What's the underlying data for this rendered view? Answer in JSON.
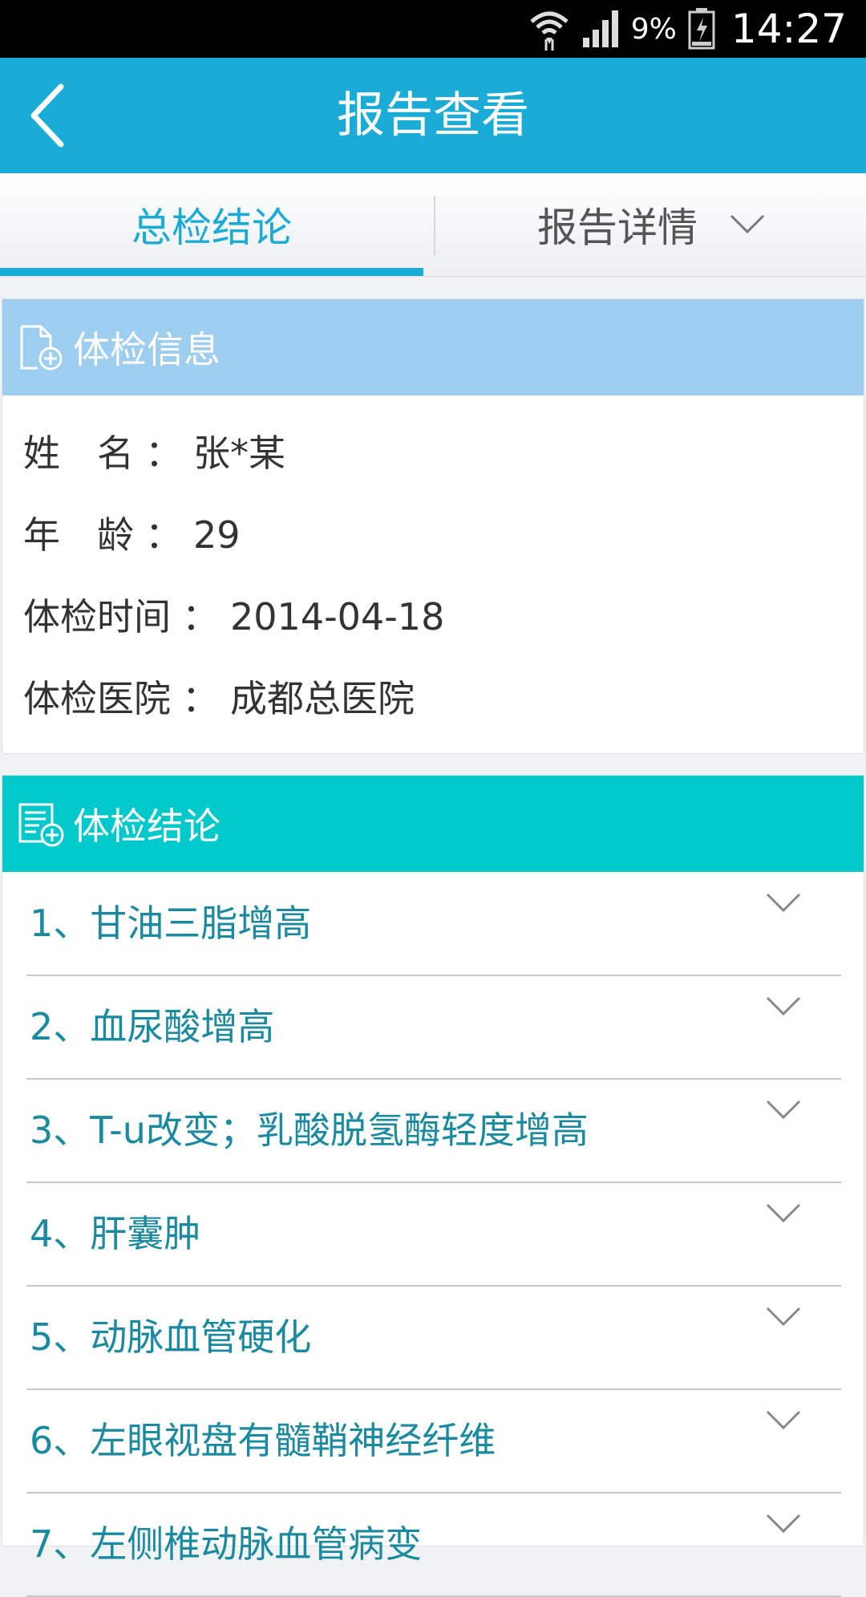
{
  "status_bar": {
    "battery_percent": "9%",
    "time": "14:27"
  },
  "header": {
    "title": "报告查看"
  },
  "tabs": [
    {
      "label": "总检结论",
      "active": true
    },
    {
      "label": "报告详情",
      "active": false
    }
  ],
  "info_section": {
    "title": "体检信息",
    "rows": [
      {
        "label": "姓　名",
        "value": "张*某"
      },
      {
        "label": "年　龄",
        "value": "29"
      },
      {
        "label": "体检时间",
        "value": "2014-04-18"
      },
      {
        "label": "体检医院",
        "value": "成都总医院"
      }
    ]
  },
  "conclusion_section": {
    "title": "体检结论",
    "items": [
      "1、甘油三脂增高",
      "2、血尿酸增高",
      "3、T-u改变；乳酸脱氢酶轻度增高",
      "4、肝囊肿",
      "5、动脉血管硬化",
      "6、左眼视盘有髓鞘神经纤维",
      "7、左侧椎动脉血管病变"
    ]
  },
  "colors": {
    "primary": "#1aabd6",
    "info_header": "#9dcdef",
    "conclusion_header": "#00c9cc",
    "conclusion_text": "#1a8aa0"
  },
  "icons": {
    "back": "chevron-left-icon",
    "dropdown": "chevron-down-icon",
    "info": "document-plus-icon",
    "conclusion": "list-plus-icon"
  }
}
